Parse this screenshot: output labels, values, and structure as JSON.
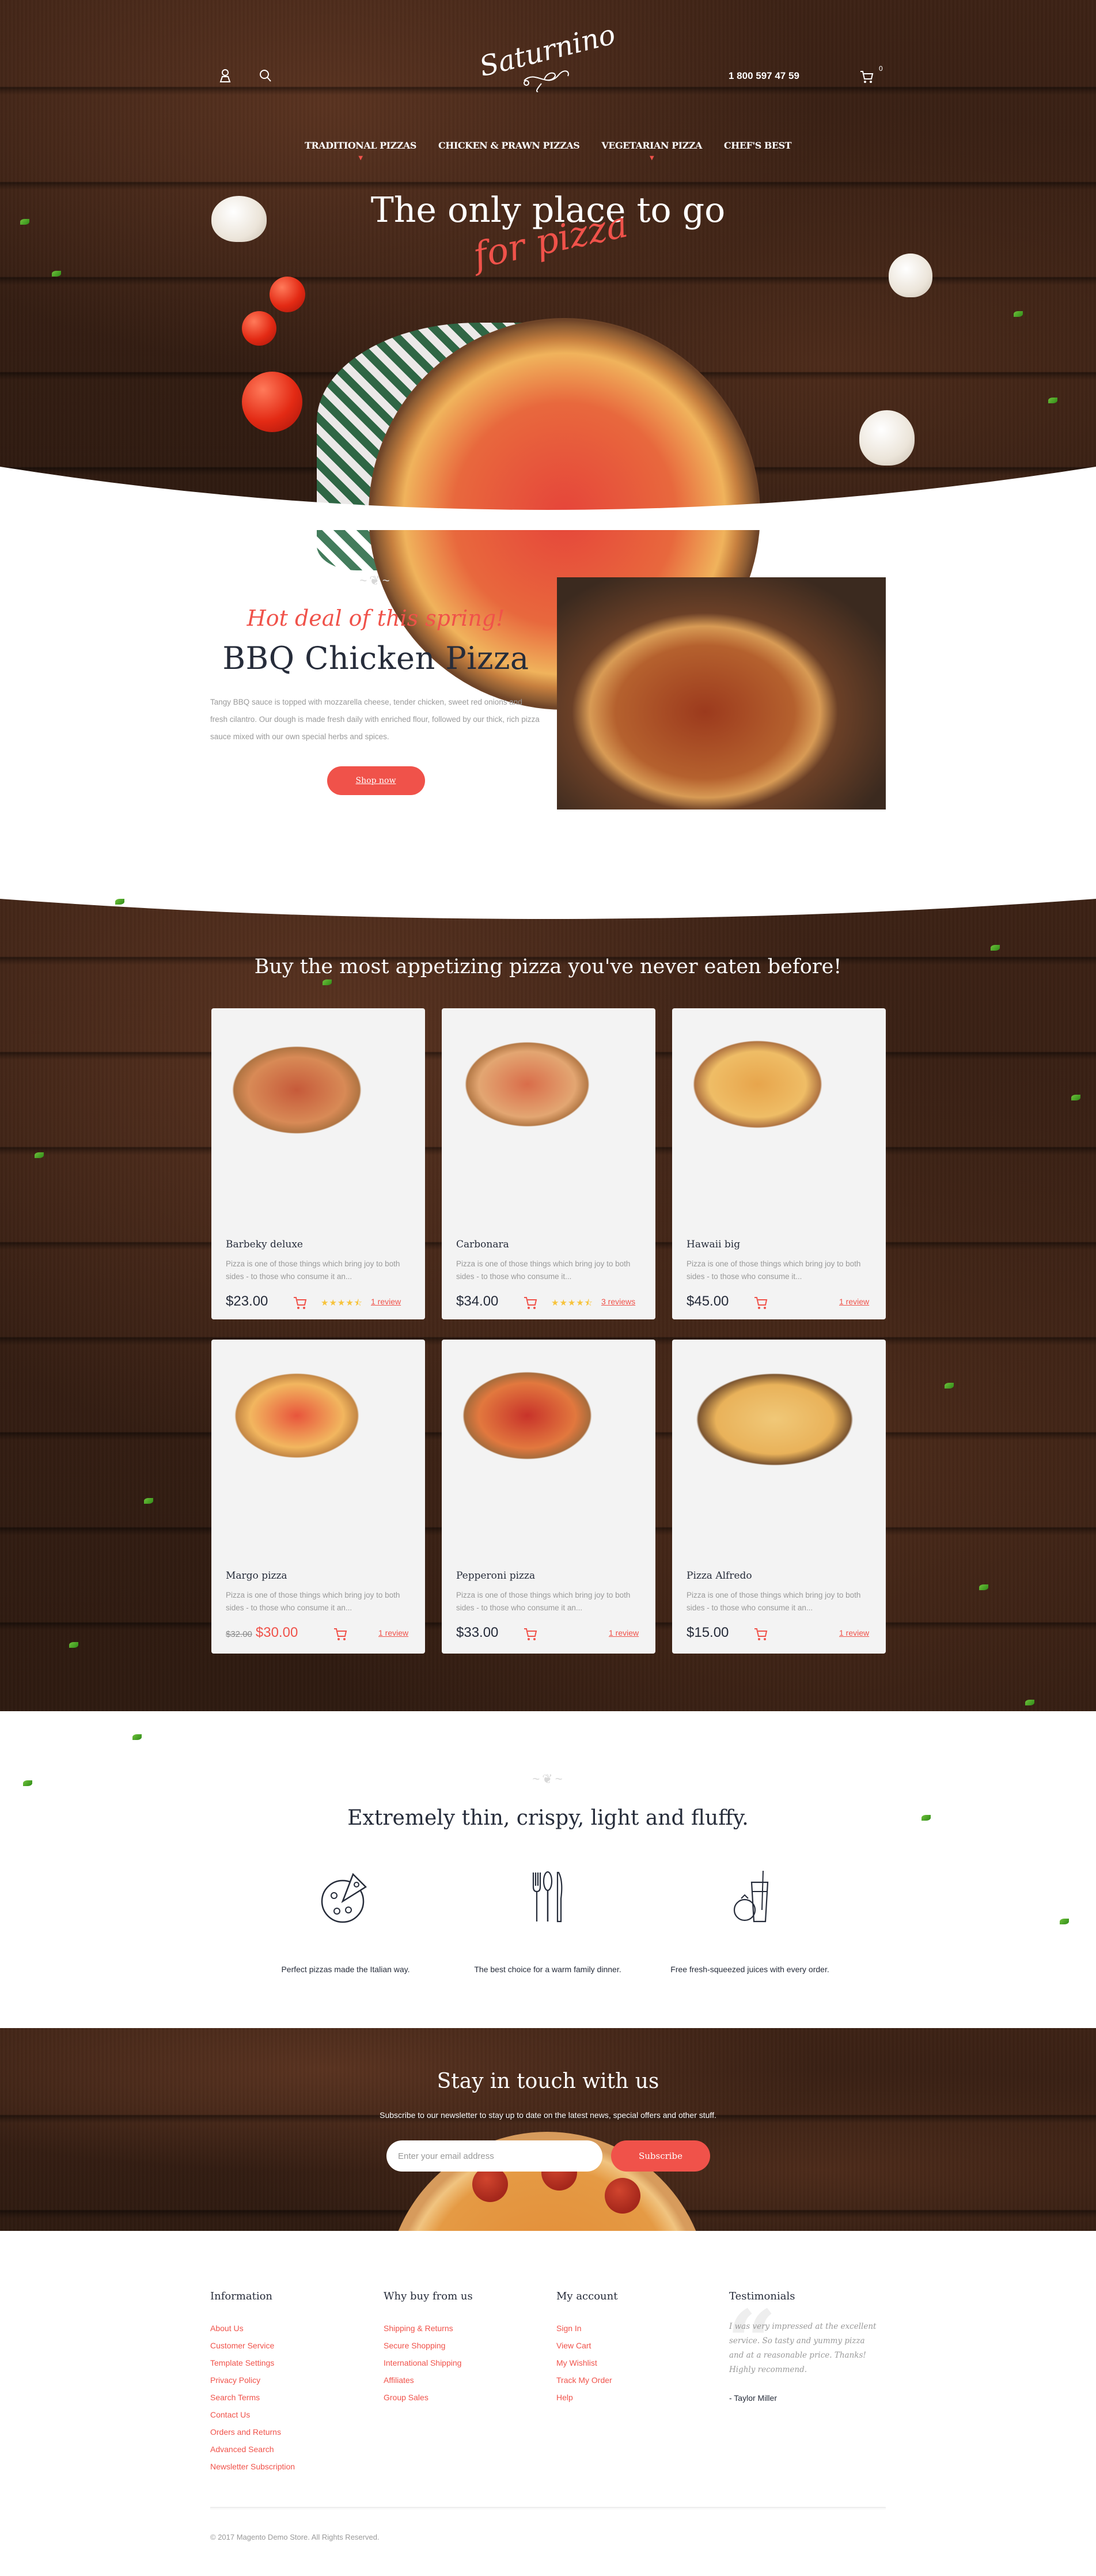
{
  "header": {
    "logo": "Saturnino",
    "phone": "1 800 597 47 59",
    "cart_count": "0",
    "icons": [
      "user-icon",
      "search-icon",
      "cart-icon"
    ]
  },
  "nav": [
    {
      "label": "TRADITIONAL PIZZAS",
      "has_dropdown": true
    },
    {
      "label": "CHICKEN & PRAWN PIZZAS",
      "has_dropdown": false
    },
    {
      "label": "VEGETARIAN PIZZA",
      "has_dropdown": true
    },
    {
      "label": "CHEF'S BEST",
      "has_dropdown": false
    }
  ],
  "hero": {
    "title": "The only place to go",
    "subtitle": "for pizza"
  },
  "deal": {
    "kicker": "Hot deal of this spring!",
    "title": "BBQ Chicken Pizza",
    "description": "Tangy BBQ sauce is topped with mozzarella cheese, tender chicken, sweet red onions and fresh cilantro. Our dough is made fresh daily with enriched flour, followed by our thick, rich pizza sauce mixed with our own special herbs and spices.",
    "button": "Shop now"
  },
  "products": {
    "title": "Buy the most appetizing pizza you've never eaten before!",
    "items": [
      {
        "name": "Barbeky deluxe",
        "description": "Pizza is one of those things which bring joy to both sides - to those who consume it an...",
        "price": "$23.00",
        "old_price": null,
        "rating": 4.5,
        "stars": "★★★★⯪",
        "reviews": "1 review"
      },
      {
        "name": "Carbonara",
        "description": "Pizza is one of those things which bring joy to both sides - to those who consume it...",
        "price": "$34.00",
        "old_price": null,
        "rating": 4.5,
        "stars": "★★★★⯪",
        "reviews": "3 reviews"
      },
      {
        "name": "Hawaii big",
        "description": "Pizza is one of those things which bring joy to both sides - to those who consume it...",
        "price": "$45.00",
        "old_price": null,
        "rating": null,
        "stars": "",
        "reviews": "1 review"
      },
      {
        "name": "Margo pizza",
        "description": "Pizza is one of those things which bring joy to both sides - to those who consume it an...",
        "price": "$30.00",
        "old_price": "$32.00",
        "rating": null,
        "stars": "",
        "reviews": "1 review"
      },
      {
        "name": "Pepperoni pizza",
        "description": "Pizza is one of those things which bring joy to both sides - to those who consume it an...",
        "price": "$33.00",
        "old_price": null,
        "rating": null,
        "stars": "",
        "reviews": "1 review"
      },
      {
        "name": "Pizza Alfredo",
        "description": "Pizza is one of those things which bring joy to both sides - to those who consume it an...",
        "price": "$15.00",
        "old_price": null,
        "rating": null,
        "stars": "",
        "reviews": "1 review"
      }
    ]
  },
  "features": {
    "title": "Extremely thin, crispy, light and fluffy.",
    "items": [
      {
        "icon": "pizza-slice-icon",
        "text": "Perfect pizzas made the Italian way."
      },
      {
        "icon": "cutlery-icon",
        "text": "The best choice for a warm family dinner."
      },
      {
        "icon": "juice-icon",
        "text": "Free fresh-squeezed juices with every order."
      }
    ]
  },
  "newsletter": {
    "title": "Stay in touch with us",
    "subtitle": "Subscribe to our newsletter to stay up to date on the latest news, special offers and other stuff.",
    "placeholder": "Enter your email address",
    "value": "",
    "button": "Subscribe"
  },
  "footer": {
    "columns": [
      {
        "title": "Information",
        "links": [
          "About Us",
          "Customer Service",
          "Template Settings",
          "Privacy Policy",
          "Search Terms",
          "Contact Us",
          "Orders and Returns",
          "Advanced Search",
          "Newsletter Subscription"
        ]
      },
      {
        "title": "Why buy from us",
        "links": [
          "Shipping & Returns",
          "Secure Shopping",
          "International Shipping",
          "Affiliates",
          "Group Sales"
        ]
      },
      {
        "title": "My account",
        "links": [
          "Sign In",
          "View Cart",
          "My Wishlist",
          "Track My Order",
          "Help"
        ]
      }
    ],
    "testimonials": {
      "title": "Testimonials",
      "quote": "I was very impressed at the excellent service. So tasty and yummy pizza and at a reasonable price. Thanks! Highly recommend.",
      "author": "- Taylor Miller"
    },
    "copyright": "© 2017 Magento Demo Store. All Rights Reserved."
  },
  "colors": {
    "accent": "#f0524a",
    "dark_text": "#262c3a",
    "muted_text": "#9a9a9a",
    "star": "#f7c33b",
    "card_bg": "#f3f3f3",
    "wood": "#3b2114"
  }
}
